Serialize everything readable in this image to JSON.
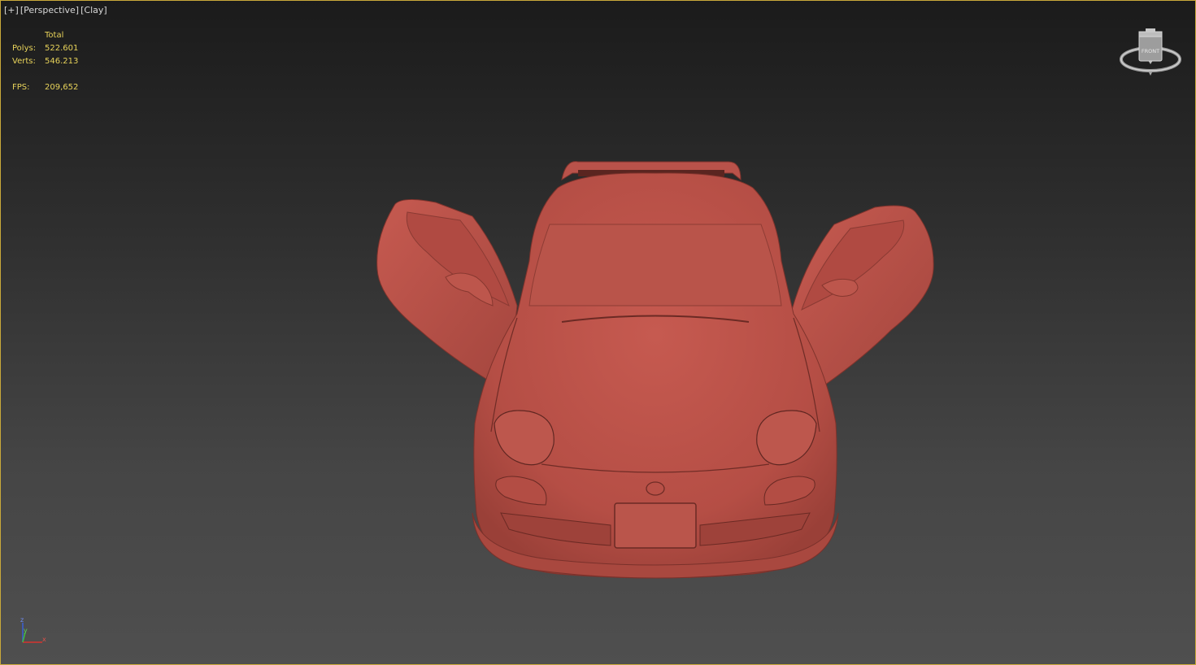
{
  "viewport": {
    "label_parts": [
      "[+]",
      "[Perspective]",
      "[Clay]"
    ],
    "active_border_color": "#c9a93a"
  },
  "stats": {
    "header": "Total",
    "polys_label": "Polys:",
    "polys_value": "522.601",
    "verts_label": "Verts:",
    "verts_value": "546.213",
    "fps_label": "FPS:",
    "fps_value": "209,652",
    "text_color": "#e8d35a"
  },
  "viewcube": {
    "face_label": "FRONT"
  },
  "axis_tripod": {
    "z": "z",
    "y": "y",
    "x": "x"
  },
  "model": {
    "material": "Clay",
    "color": "#c0534a",
    "icon": "car-model"
  }
}
